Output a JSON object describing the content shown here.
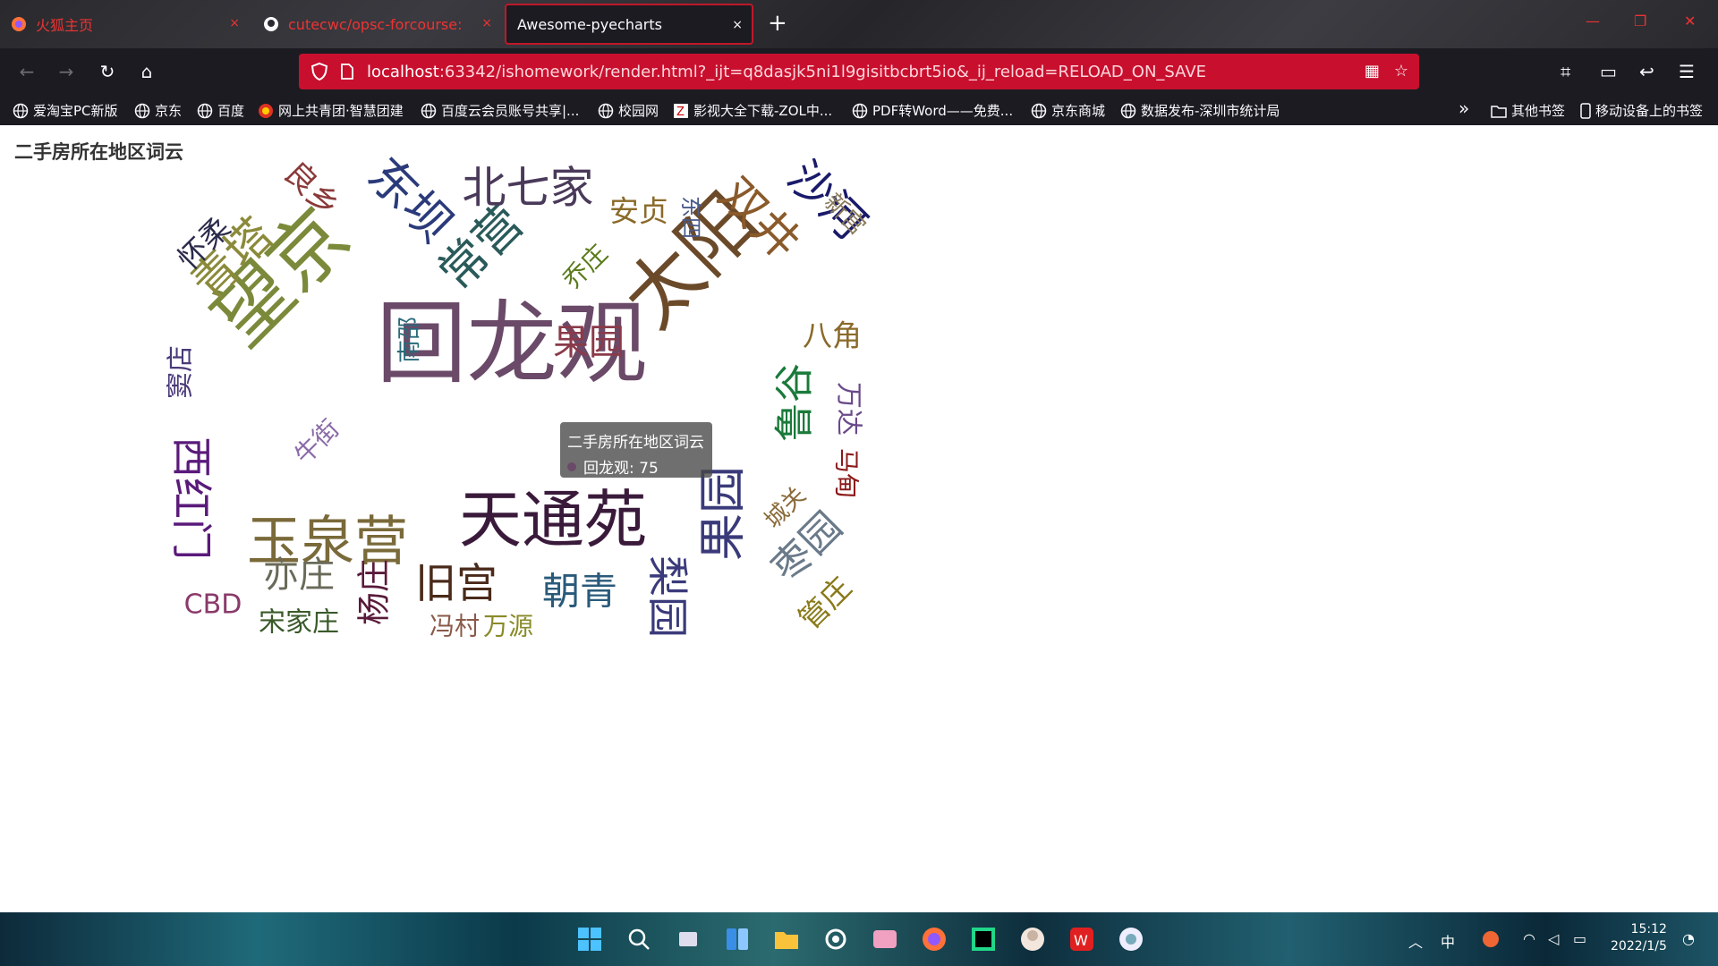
{
  "browser": {
    "tabs": [
      {
        "title": "火狐主页",
        "close": "×"
      },
      {
        "title": "cutecwc/opsc-forcourse: 202",
        "close": "×"
      },
      {
        "title": "Awesome-pyecharts",
        "close": "×"
      }
    ],
    "new_tab": "+",
    "url_host": "localhost",
    "url_rest": ":63342/ishomework/render.html?_ijt=q8dasjk5ni1l9gisitbcbrt5io&_ij_reload=RELOAD_ON_SAVE",
    "bookmarks": [
      "爱淘宝PC新版",
      "京东",
      "百度",
      "网上共青团·智慧团建",
      "百度云会员账号共享|...",
      "校园网",
      "影视大全下载-ZOL中...",
      "PDF转Word——免费...",
      "京东商城",
      "数据发布-深圳市统计局"
    ],
    "other_bookmarks": "其他书签",
    "mobile_bookmarks": "移动设备上的书签",
    "more": "»"
  },
  "page": {
    "title": "二手房所在地区词云"
  },
  "tooltip": {
    "series": "二手房所在地区词云",
    "item": "回龙观: 75"
  },
  "chart_data": {
    "type": "wordcloud",
    "title": "二手房所在地区词云",
    "words": [
      {
        "name": "回龙观",
        "value": 75,
        "color": "#6a4a68"
      },
      {
        "name": "望京",
        "value": 62,
        "color": "#7a8a3a"
      },
      {
        "name": "太阳",
        "value": 60,
        "color": "#6b4a2a"
      },
      {
        "name": "天通苑",
        "value": 48,
        "color": "#3a1a3a"
      },
      {
        "name": "玉泉营",
        "value": 40,
        "color": "#7a6a3a"
      },
      {
        "name": "果园",
        "value": 34,
        "color": "#3a3a7a"
      },
      {
        "name": "东坝",
        "value": 34,
        "color": "#2a3a7a"
      },
      {
        "name": "常营",
        "value": 34,
        "color": "#2a5a5a"
      },
      {
        "name": "双井",
        "value": 32,
        "color": "#8a5a2a"
      },
      {
        "name": "青塔",
        "value": 32,
        "color": "#8a8a3a"
      },
      {
        "name": "北七家",
        "value": 30,
        "color": "#4a3a5a"
      },
      {
        "name": "沙河",
        "value": 30,
        "color": "#1a1a6a"
      },
      {
        "name": "西红门",
        "value": 28,
        "color": "#5a1a7a"
      },
      {
        "name": "旧宫",
        "value": 28,
        "color": "#4a2a1a"
      },
      {
        "name": "梨园",
        "value": 28,
        "color": "#3a3a7a"
      },
      {
        "name": "鲁谷",
        "value": 26,
        "color": "#1a7a3a"
      },
      {
        "name": "枣园",
        "value": 26,
        "color": "#6a7a8a"
      },
      {
        "name": "朝青",
        "value": 24,
        "color": "#2a5a7a"
      },
      {
        "name": "果园",
        "value": 22,
        "color": "#8a3a4a"
      },
      {
        "name": "亦庄",
        "value": 22,
        "color": "#6a6a5a"
      },
      {
        "name": "杨庄",
        "value": 20,
        "color": "#5a1a3a"
      },
      {
        "name": "良乡",
        "value": 18,
        "color": "#8a3a3a"
      },
      {
        "name": "怀柔",
        "value": 16,
        "color": "#2a2a4a"
      },
      {
        "name": "安贞",
        "value": 16,
        "color": "#8a6a2a"
      },
      {
        "name": "八角",
        "value": 16,
        "color": "#8a6a2a"
      },
      {
        "name": "管庄",
        "value": 16,
        "color": "#8a7a1a"
      },
      {
        "name": "CBD",
        "value": 14,
        "color": "#8a3a6a"
      },
      {
        "name": "宋家庄",
        "value": 14,
        "color": "#3a5a2a"
      },
      {
        "name": "窦店",
        "value": 14,
        "color": "#4a3a7a"
      },
      {
        "name": "万达",
        "value": 14,
        "color": "#6a4a8a"
      },
      {
        "name": "乔庄",
        "value": 12,
        "color": "#5a7a1a"
      },
      {
        "name": "牛街",
        "value": 12,
        "color": "#8a6aa8"
      },
      {
        "name": "冯村",
        "value": 12,
        "color": "#8a5a4a"
      },
      {
        "name": "万源",
        "value": 12,
        "color": "#8a8a2a"
      },
      {
        "name": "马甸",
        "value": 12,
        "color": "#8a1a1a"
      },
      {
        "name": "城关",
        "value": 10,
        "color": "#8a6a3a"
      },
      {
        "name": "新宫",
        "value": 10,
        "color": "#8a7a5a"
      },
      {
        "name": "南邵",
        "value": 10,
        "color": "#2a6a7a"
      },
      {
        "name": "东四",
        "value": 9,
        "color": "#4a5a8a"
      }
    ]
  },
  "taskbar": {
    "ime": "中",
    "time": "15:12",
    "date": "2022/1/5"
  }
}
